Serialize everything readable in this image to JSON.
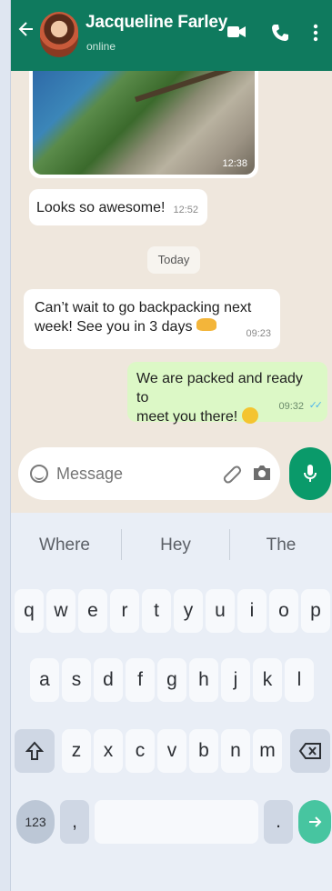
{
  "header": {
    "back_icon": "arrow-left-icon",
    "contact_name": "Jacqueline Farley",
    "status": "online",
    "icons": [
      "video-camera-icon",
      "phone-icon",
      "more-vertical-icon"
    ],
    "color": "#0f7a5e"
  },
  "chat": {
    "background": "#efe7dd",
    "media_time": "12:38",
    "messages": [
      {
        "direction": "in",
        "text": "Looks so awesome!",
        "time": "12:52"
      },
      {
        "direction": "in",
        "text_line1": "Can’t wait to go backpacking next",
        "text_line2": "week! See you in 3 days",
        "emoji": "heart-hands-emoji",
        "time": "09:23"
      },
      {
        "direction": "out",
        "text_line1": "We are packed and ready to",
        "text_line2": "meet you there!",
        "emoji": "smiling-face-emoji",
        "time": "09:32",
        "status": "read"
      }
    ],
    "date_separator": "Today"
  },
  "composer": {
    "placeholder": "Message",
    "icons": [
      "emoji-icon",
      "attach-icon",
      "camera-icon",
      "mic-icon"
    ]
  },
  "keyboard": {
    "suggestions": [
      "Where",
      "Hey",
      "The"
    ],
    "row1": [
      "q",
      "w",
      "e",
      "r",
      "t",
      "y",
      "u",
      "i",
      "o",
      "p"
    ],
    "row2": [
      "a",
      "s",
      "d",
      "f",
      "g",
      "h",
      "j",
      "k",
      "l"
    ],
    "row3": [
      "z",
      "x",
      "c",
      "v",
      "b",
      "n",
      "m"
    ],
    "numbers_key": "123",
    "comma_key": ",",
    "period_key": ".",
    "enter_icon": "arrow-right-icon",
    "shift_icon": "shift-icon",
    "backspace_icon": "backspace-icon"
  }
}
